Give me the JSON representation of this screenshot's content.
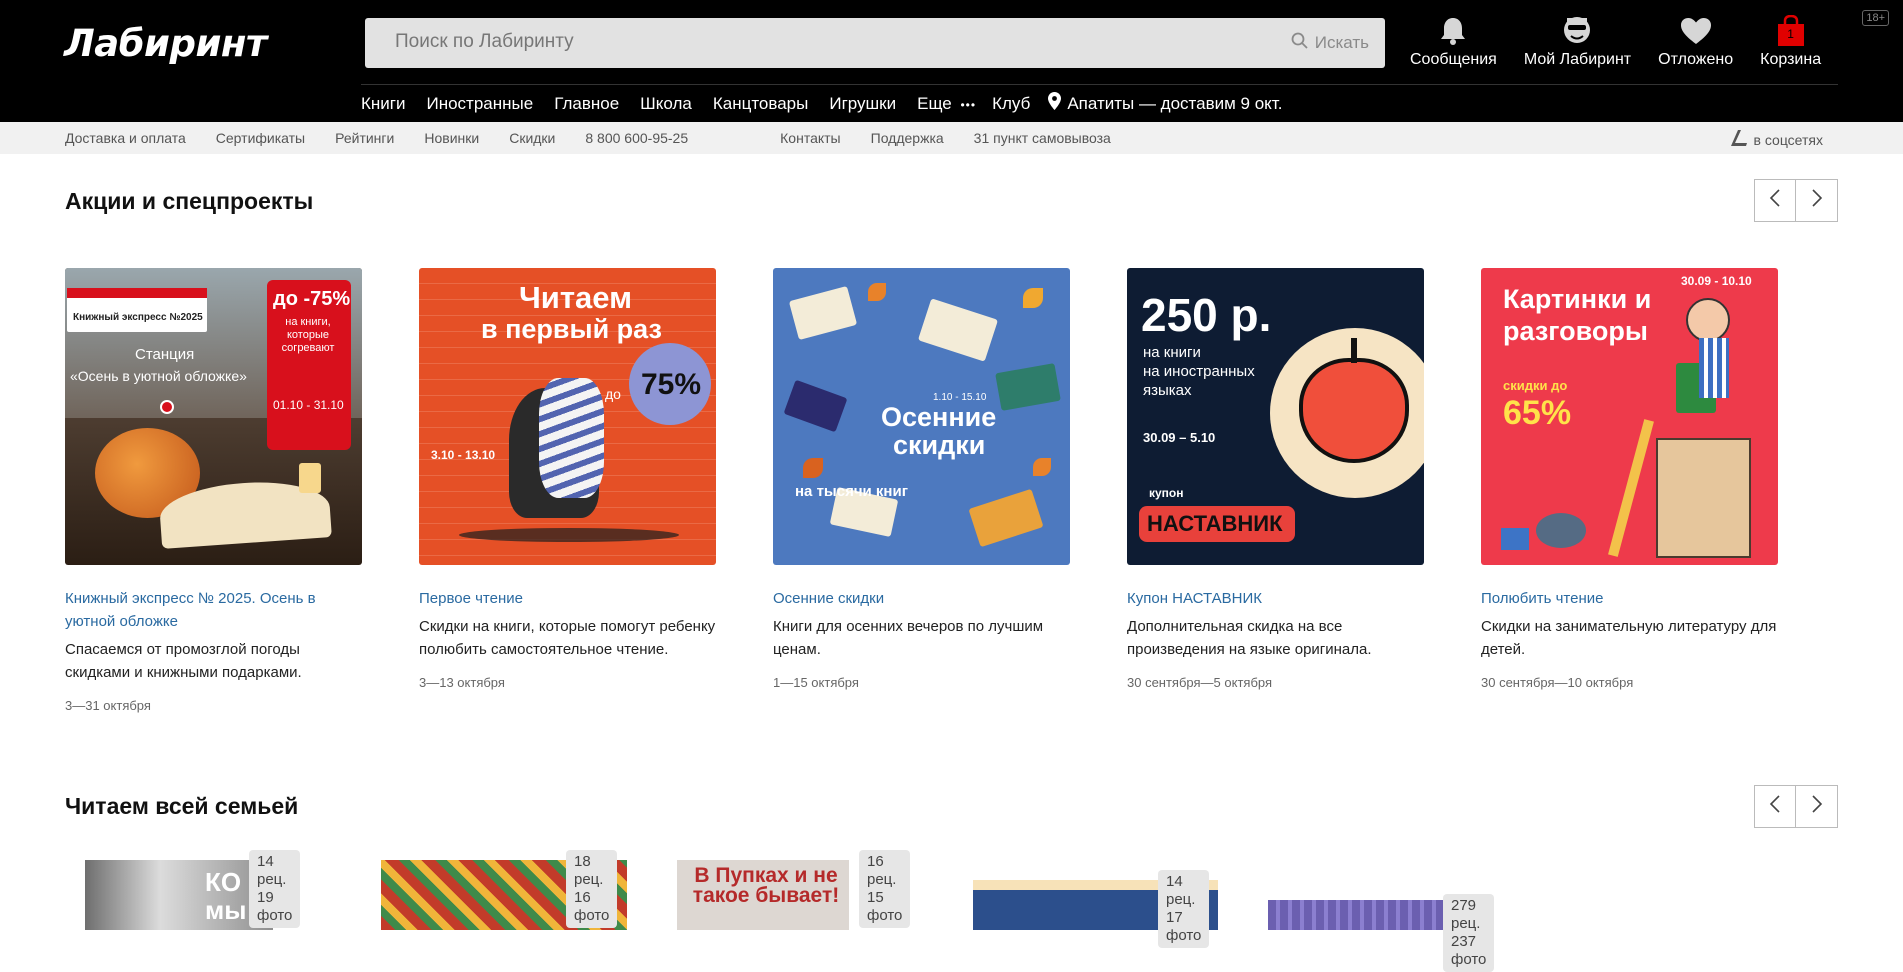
{
  "header": {
    "logo": "Лабиринт",
    "search_placeholder": "Поиск по Лабиринту",
    "search_button": "Искать",
    "icons": [
      {
        "name": "bell-icon",
        "label": "Сообщения"
      },
      {
        "name": "user-icon",
        "label": "Мой Лабиринт"
      },
      {
        "name": "heart-icon",
        "label": "Отложено"
      },
      {
        "name": "bag-icon",
        "label": "Корзина"
      }
    ],
    "cart_count": "1",
    "age_label": "18+"
  },
  "nav": {
    "items": [
      "Книги",
      "Иностранные",
      "Главное",
      "Школа",
      "Канцтовары",
      "Игрушки",
      "Еще"
    ],
    "more_dots": "•••",
    "club": "Клуб",
    "location": "Апатиты — доставим 9 окт."
  },
  "subbar": {
    "left": [
      "Доставка и оплата",
      "Сертификаты",
      "Рейтинги",
      "Новинки",
      "Скидки",
      "8 800 600-95-25"
    ],
    "right": [
      "Контакты",
      "Поддержка",
      "31 пункт самовывоза"
    ],
    "social": "в соцсетях"
  },
  "sections": {
    "promos_title": "Акции и спецпроекты",
    "family_title": "Читаем всей семьей"
  },
  "promos": [
    {
      "title": "Книжный экспресс № 2025. Осень в уютной обложке",
      "desc": "Спасаемся от промозглой погоды скидками и книжными подарками.",
      "date": "3—31 октября",
      "img_text": [
        "Книжный экспресс №2025",
        "Станция",
        "«Осень в уютной обложке»",
        "до -75%",
        "на книги, которые согревают",
        "01.10 - 31.10"
      ]
    },
    {
      "title": "Первое чтение",
      "desc": "Скидки на книги, которые помогут ребенку полюбить самостоятельное чтение.",
      "date": "3—13 октября",
      "img_text": [
        "Читаем",
        "в первый раз",
        "до",
        "75%",
        "3.10 - 13.10"
      ]
    },
    {
      "title": "Осенние скидки",
      "desc": "Книги для осенних вечеров по лучшим ценам.",
      "date": "1—15 октября",
      "img_text": [
        "1.10 - 15.10",
        "Осенние",
        "скидки",
        "на тысячи книг"
      ]
    },
    {
      "title": "Купон НАСТАВНИК",
      "desc": "Дополнительная скидка на все произведения на языке оригинала.",
      "date": "30 сентября—5 октября",
      "img_text": [
        "250 р.",
        "на книги",
        "на иностранных",
        "языках",
        "30.09 – 5.10",
        "купон",
        "НАСТАВНИК"
      ]
    },
    {
      "title": "Полюбить чтение",
      "desc": "Скидки на занимательную литературу для детей.",
      "date": "30 сентября—10 октября",
      "img_text": [
        "30.09 - 10.10",
        "Картинки и",
        "разговоры",
        "скидки до",
        "65%"
      ]
    }
  ],
  "family_books": [
    {
      "reviews": "14 рец.",
      "photos": "19 фото",
      "cover_text": "КО мы"
    },
    {
      "reviews": "18 рец.",
      "photos": "16 фото",
      "cover_text": ""
    },
    {
      "reviews": "16 рец.",
      "photos": "15 фото",
      "cover_text": "В Пупках и не такое бывает!"
    },
    {
      "reviews": "14 рец.",
      "photos": "17 фото",
      "cover_text": ""
    },
    {
      "reviews": "279 рец.",
      "photos": "237 фото",
      "cover_text": ""
    }
  ]
}
